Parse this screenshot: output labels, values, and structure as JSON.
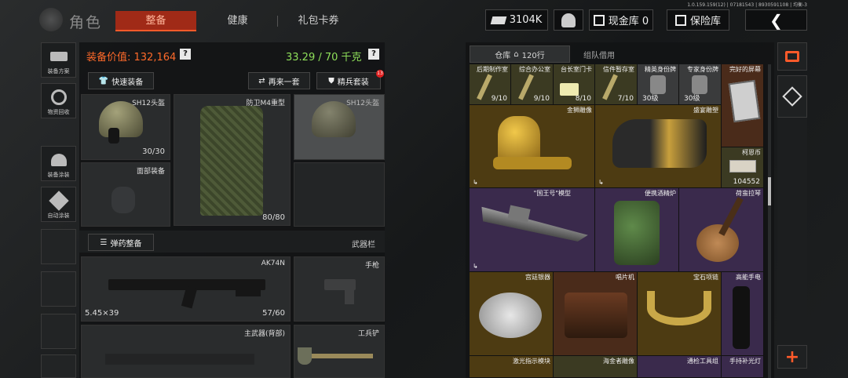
{
  "version": "1.0.159.159(12) | 07181543 | 8930591108 | 均衡-3",
  "header": {
    "title": "角色",
    "tabs": [
      {
        "label": "整备",
        "active": true
      },
      {
        "label": "健康",
        "active": false
      },
      {
        "label": "礼包卡券",
        "active": false
      }
    ],
    "currency": "3104K",
    "cash_vault": "现金库 0",
    "safe_vault": "保险库"
  },
  "left_sidebar": [
    {
      "label": "装备方案",
      "icon": "gun-scheme-icon"
    },
    {
      "label": "物资回收",
      "icon": "recycle-icon"
    },
    {
      "label": "装备涂装",
      "icon": "helmet-paint-icon"
    },
    {
      "label": "自动涂装",
      "icon": "auto-paint-icon"
    }
  ],
  "loadout": {
    "value_label": "装备价值: 132,164",
    "weight": "33.29 / 70 千克",
    "quick_equip": "快速装备",
    "again": "再来一套",
    "elite_set": "精兵套装",
    "elite_badge": "13",
    "helmet": {
      "label": "SH12头盔",
      "count": "30/30"
    },
    "armor": {
      "label": "防卫M4重型",
      "count": "80/80"
    },
    "helmet2": {
      "label": "SH12头盔"
    },
    "face": {
      "label": "面部装备"
    },
    "ammo_btn": "弹药整备",
    "weapon_bar": "武器栏",
    "primary": {
      "label": "AK74N",
      "caliber": "5.45×39",
      "ammo": "57/60"
    },
    "pistol": {
      "label": "手枪"
    },
    "back": {
      "label": "主武器(背部)"
    },
    "shovel": {
      "label": "工兵铲"
    }
  },
  "storage": {
    "tab_warehouse": "仓库",
    "rows": "120行",
    "tab_team": "组队借用",
    "items_row1": [
      {
        "label": "后期制作室",
        "count": "9/10"
      },
      {
        "label": "综合办公室",
        "count": "9/10"
      },
      {
        "label": "台长室门卡",
        "count": "8/10"
      },
      {
        "label": "信件暂存室",
        "count": "7/10"
      },
      {
        "label": "精英身份牌",
        "count": "30级"
      },
      {
        "label": "专家身份牌",
        "count": "30级"
      },
      {
        "label": "完好的屏幕",
        "count": ""
      }
    ],
    "gold_lion": "金狮雕像",
    "fancy_sculpture": "盛宴雕塑",
    "coin": {
      "label": "柯恩币",
      "count": "104552"
    },
    "warship": "\"国王号\"模型",
    "stove": "便携酒精炉",
    "guitar": "荷蛮拉琴",
    "items_row3": [
      "宫廷银器",
      "唱片机",
      "宝石项链",
      "高能手电"
    ],
    "items_row4": [
      "激光指示模块",
      "海金者雕像",
      "通检工具组",
      "手持补光灯"
    ],
    "add": "+"
  }
}
